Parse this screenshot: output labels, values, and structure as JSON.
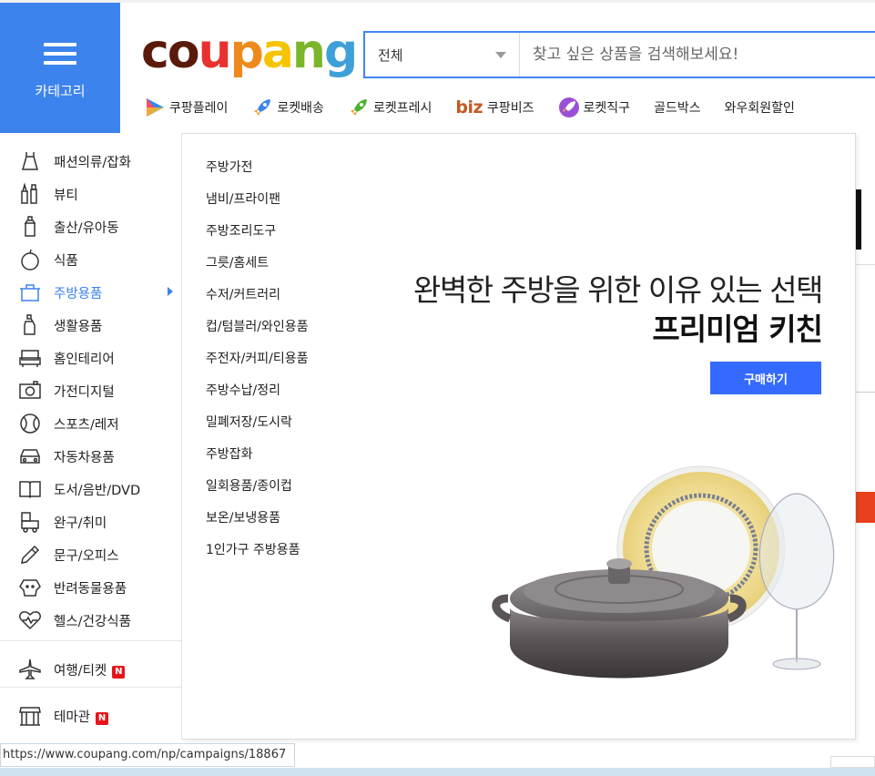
{
  "header": {
    "category_label": "카테고리",
    "logo_text": "coupang",
    "logo_colors": [
      "#5a1a0a",
      "#5a1a0a",
      "#e8322f",
      "#ee8a1b",
      "#f5c400",
      "#7bb52a",
      "#3ea0d8"
    ]
  },
  "search": {
    "scope_label": "전체",
    "placeholder": "찾고 싶은 상품을 검색해보세요!"
  },
  "subnav": {
    "items": [
      {
        "label": "쿠팡플레이",
        "icon": "coupang-play-icon"
      },
      {
        "label": "로켓배송",
        "icon": "rocket-icon"
      },
      {
        "label": "로켓프레시",
        "icon": "rocket-fresh-icon"
      },
      {
        "label": "쿠팡비즈",
        "prefix": "biz"
      },
      {
        "label": "로켓직구",
        "icon": "rocket-global-icon"
      },
      {
        "label": "골드박스"
      },
      {
        "label": "와우회원할인"
      }
    ]
  },
  "categories": [
    {
      "label": "패션의류/잡화",
      "icon": "dress-icon"
    },
    {
      "label": "뷰티",
      "icon": "cosmetics-icon"
    },
    {
      "label": "출산/유아동",
      "icon": "baby-bottle-icon"
    },
    {
      "label": "식품",
      "icon": "apple-icon"
    },
    {
      "label": "주방용품",
      "icon": "kitchen-icon",
      "active": true
    },
    {
      "label": "생활용품",
      "icon": "detergent-icon"
    },
    {
      "label": "홈인테리어",
      "icon": "sofa-icon"
    },
    {
      "label": "가전디지털",
      "icon": "camera-icon"
    },
    {
      "label": "스포츠/레저",
      "icon": "ball-icon"
    },
    {
      "label": "자동차용품",
      "icon": "car-icon"
    },
    {
      "label": "도서/음반/DVD",
      "icon": "book-icon"
    },
    {
      "label": "완구/취미",
      "icon": "toy-icon"
    },
    {
      "label": "문구/오피스",
      "icon": "pencil-icon"
    },
    {
      "label": "반려동물용품",
      "icon": "dog-icon"
    },
    {
      "label": "헬스/건강식품",
      "icon": "heart-pulse-icon"
    },
    {
      "label": "여행/티켓",
      "icon": "airplane-icon",
      "badge": "N"
    },
    {
      "label": "테마관",
      "icon": "store-icon",
      "badge": "N"
    }
  ],
  "subcategories": [
    "주방가전",
    "냄비/프라이팬",
    "주방조리도구",
    "그릇/홈세트",
    "수저/커트러리",
    "컵/텀블러/와인용품",
    "주전자/커피/티용품",
    "주방수납/정리",
    "밀폐저장/도시락",
    "주방잡화",
    "일회용품/종이컵",
    "보온/보냉용품",
    "1인가구 주방용품"
  ],
  "promo": {
    "line1": "완벽한 주방을 위한 이유 있는 선택",
    "line2": "프리미엄 키친",
    "button": "구매하기",
    "button_color": "#346aff"
  },
  "statusbar": {
    "url": "https://www.coupang.com/np/campaigns/18867"
  },
  "colors": {
    "accent": "#3c83ed",
    "badge": "#e5151b"
  }
}
